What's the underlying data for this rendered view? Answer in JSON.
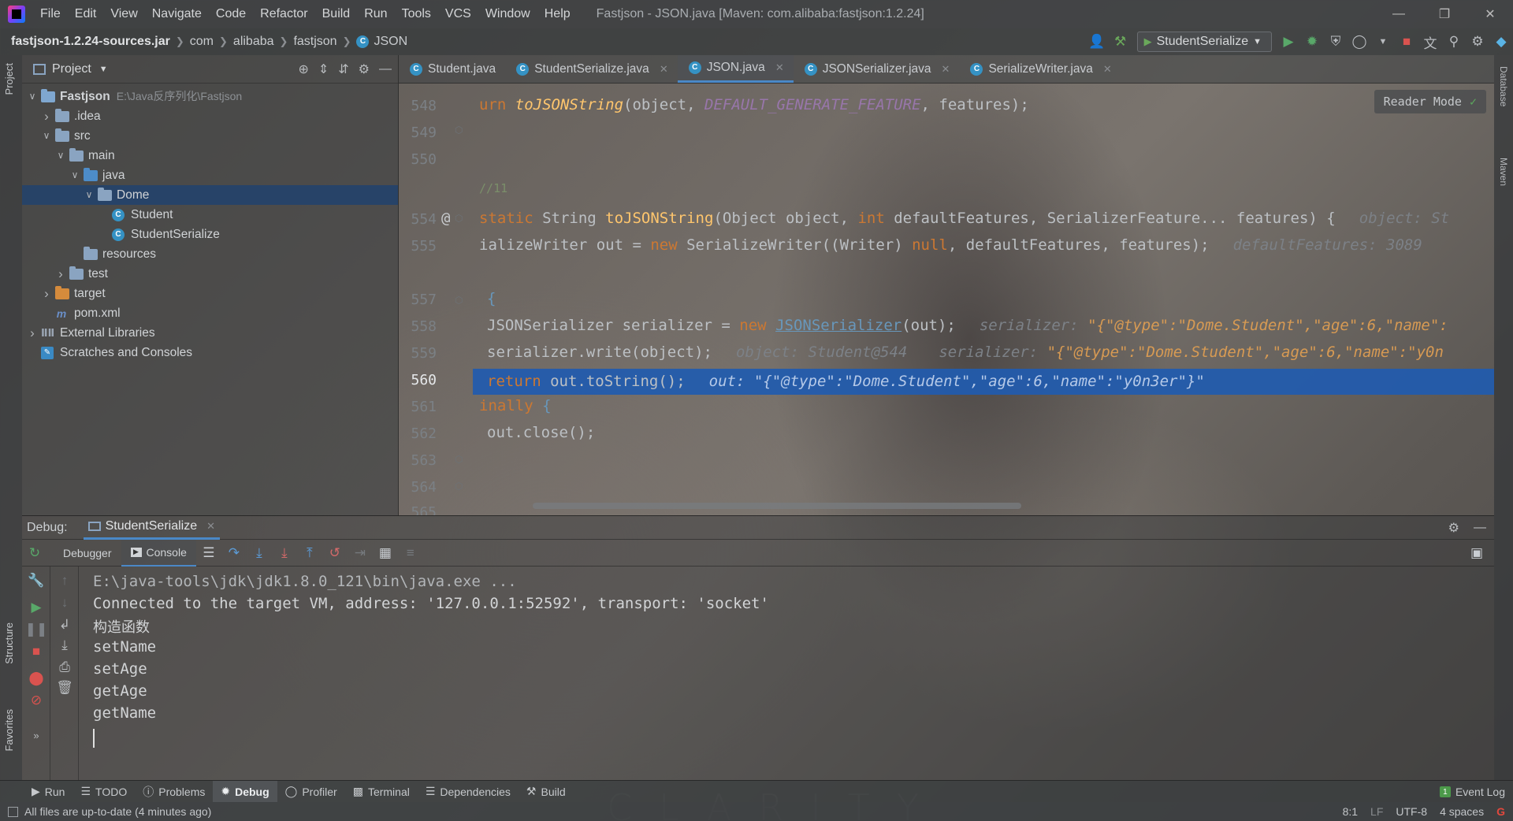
{
  "window": {
    "title": "Fastjson - JSON.java [Maven: com.alibaba:fastjson:1.2.24]"
  },
  "menu": [
    "File",
    "Edit",
    "View",
    "Navigate",
    "Code",
    "Refactor",
    "Build",
    "Run",
    "Tools",
    "VCS",
    "Window",
    "Help"
  ],
  "breadcrumbs": [
    "fastjson-1.2.24-sources.jar",
    "com",
    "alibaba",
    "fastjson",
    "JSON"
  ],
  "run_config": "StudentSerialize",
  "left_stripe": {
    "project": "Project",
    "structure": "Structure",
    "favorites": "Favorites"
  },
  "right_stripe": {
    "database": "Database",
    "maven": "Maven"
  },
  "project": {
    "title": "Project",
    "tree": [
      {
        "label": "Fastjson",
        "hint": "E:\\Java反序列化\\Fastjson",
        "type": "module",
        "depth": 0,
        "expanded": true
      },
      {
        "label": ".idea",
        "type": "folder",
        "depth": 1,
        "expanded": false
      },
      {
        "label": "src",
        "type": "folder",
        "depth": 1,
        "expanded": true
      },
      {
        "label": "main",
        "type": "folder",
        "depth": 2,
        "expanded": true
      },
      {
        "label": "java",
        "type": "source-folder",
        "depth": 3,
        "expanded": true
      },
      {
        "label": "Dome",
        "type": "package",
        "depth": 4,
        "expanded": true,
        "selected": true
      },
      {
        "label": "Student",
        "type": "class",
        "depth": 5
      },
      {
        "label": "StudentSerialize",
        "type": "class",
        "depth": 5
      },
      {
        "label": "resources",
        "type": "resources-folder",
        "depth": 3
      },
      {
        "label": "test",
        "type": "folder",
        "depth": 2,
        "expanded": false
      },
      {
        "label": "target",
        "type": "excluded-folder",
        "depth": 1,
        "expanded": false
      },
      {
        "label": "pom.xml",
        "type": "maven-file",
        "depth": 1
      },
      {
        "label": "External Libraries",
        "type": "libraries",
        "depth": 0,
        "expanded": false
      },
      {
        "label": "Scratches and Consoles",
        "type": "scratches",
        "depth": 0
      }
    ]
  },
  "editor": {
    "tabs": [
      {
        "label": "Student.java",
        "active": false
      },
      {
        "label": "StudentSerialize.java",
        "active": false
      },
      {
        "label": "JSON.java",
        "active": true
      },
      {
        "label": "JSONSerializer.java",
        "active": false
      },
      {
        "label": "SerializeWriter.java",
        "active": false
      }
    ],
    "reader_mode": "Reader Mode",
    "lines": {
      "l548": {
        "num": "548",
        "a": "urn ",
        "b": "toJSONString",
        "c": "(object, ",
        "d": "DEFAULT_GENERATE_FEATURE",
        "e": ", features);"
      },
      "l549": {
        "num": "549"
      },
      "l550": {
        "num": "550"
      },
      "l551_comment": "11",
      "l554": {
        "num": "554",
        "a": "static ",
        "b": "String ",
        "c": "toJSONString",
        "d": "(Object object, ",
        "e": "int ",
        "f": "defaultFeatures, SerializerFeature... features) {",
        "inlay": "object: St"
      },
      "l555": {
        "num": "555",
        "a": "ializeWriter out = ",
        "b": "new ",
        "c": "SerializeWriter((Writer) ",
        "d": "null",
        "e": ", defaultFeatures, features);",
        "inlay": "defaultFeatures: 3089"
      },
      "l557": {
        "num": "557",
        "a": "{"
      },
      "l558": {
        "num": "558",
        "a": "JSONSerializer serializer = ",
        "b": "new ",
        "c": "JSONSerializer",
        "d": "(out);",
        "inlay_label": "serializer: ",
        "inlay_val": "\"{\"@type\":\"Dome.Student\",\"age\":6,\"name\":"
      },
      "l559": {
        "num": "559",
        "a": "serializer.write(object);",
        "inlay1": "object: Student@544",
        "inlay_label": "serializer: ",
        "inlay_val": "\"{\"@type\":\"Dome.Student\",\"age\":6,\"name\":\"y0n"
      },
      "l560": {
        "num": "560",
        "a": "return ",
        "b": "out.toString();",
        "inlay": "out: \"{\"@type\":\"Dome.Student\",\"age\":6,\"name\":\"y0n3er\"}\""
      },
      "l561": {
        "num": "561",
        "a": "inally ",
        "b": "{"
      },
      "l562": {
        "num": "562",
        "a": "out.close();"
      },
      "l563": {
        "num": "563"
      },
      "l564": {
        "num": "564"
      },
      "l565": {
        "num": "565"
      }
    }
  },
  "debug": {
    "label": "Debug:",
    "session": "StudentSerialize",
    "subtabs": [
      "Debugger",
      "Console"
    ],
    "console": [
      "E:\\java-tools\\jdk\\jdk1.8.0_121\\bin\\java.exe ...",
      "Connected to the target VM, address: '127.0.0.1:52592', transport: 'socket'",
      "构造函数",
      "setName",
      "setAge",
      "getAge",
      "getName"
    ]
  },
  "toolwindows": [
    "Run",
    "TODO",
    "Problems",
    "Debug",
    "Profiler",
    "Terminal",
    "Dependencies",
    "Build"
  ],
  "active_toolwindow": "Debug",
  "event_log": "Event Log",
  "watermark": "CLARITY",
  "status": {
    "message": "All files are up-to-date (4 minutes ago)",
    "position": "8:1",
    "line_sep": "LF",
    "encoding": "UTF-8",
    "indent": "4 spaces"
  },
  "colors": {
    "accent": "#4a88c7",
    "selection": "#215bae",
    "keyword": "#cc7832",
    "function": "#ffc66d",
    "constant": "#9876aa"
  }
}
